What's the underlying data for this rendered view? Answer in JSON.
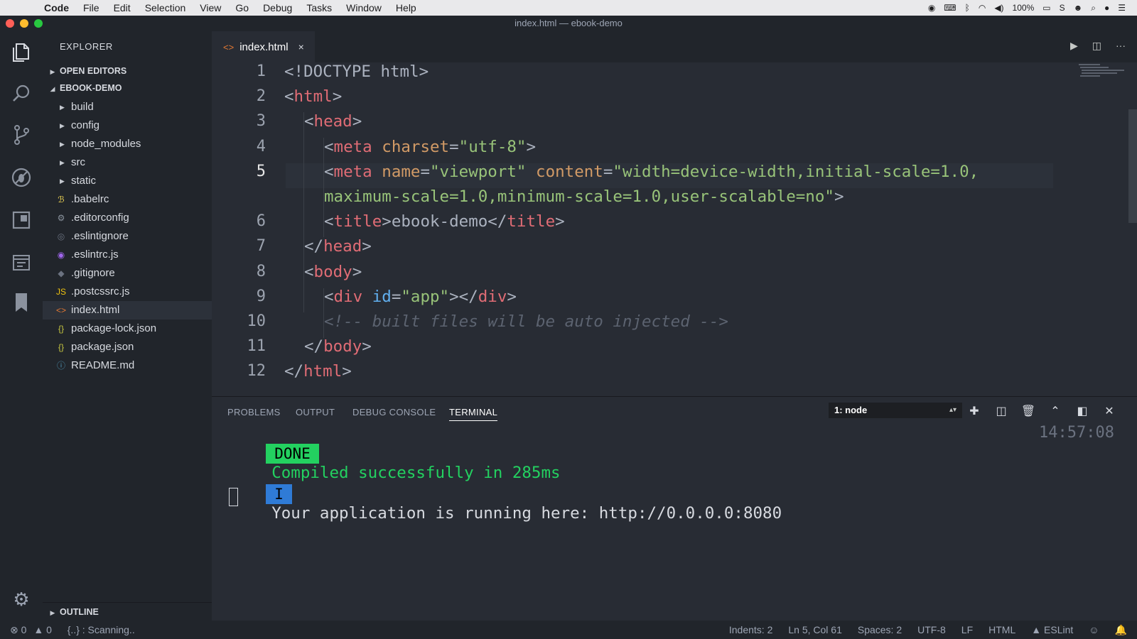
{
  "menubar": {
    "app": "Code",
    "items": [
      "File",
      "Edit",
      "Selection",
      "View",
      "Go",
      "Debug",
      "Tasks",
      "Window",
      "Help"
    ],
    "battery": "100%"
  },
  "window": {
    "title": "index.html — ebook-demo"
  },
  "sidebar": {
    "title": "EXPLORER",
    "open_editors": "OPEN EDITORS",
    "project": "EBOOK-DEMO",
    "folders": [
      "build",
      "config",
      "node_modules",
      "src",
      "static"
    ],
    "files": [
      {
        "name": ".babelrc",
        "icon": "babel-icon",
        "glyph": "ℬ",
        "color": "#f5da55"
      },
      {
        "name": ".editorconfig",
        "icon": "gear-file-icon",
        "glyph": "⚙",
        "color": "#8b949e"
      },
      {
        "name": ".eslintignore",
        "icon": "eslint-ignore-icon",
        "glyph": "◎",
        "color": "#6b7280"
      },
      {
        "name": ".eslintrc.js",
        "icon": "eslint-icon",
        "glyph": "◉",
        "color": "#a066ec"
      },
      {
        "name": ".gitignore",
        "icon": "git-icon",
        "glyph": "◆",
        "color": "#6b7280"
      },
      {
        "name": ".postcssrc.js",
        "icon": "js-icon",
        "glyph": "JS",
        "color": "#f1c40f"
      },
      {
        "name": "index.html",
        "icon": "html-icon",
        "glyph": "<>",
        "color": "#e37933"
      },
      {
        "name": "package-lock.json",
        "icon": "json-icon",
        "glyph": "{}",
        "color": "#cbcb41"
      },
      {
        "name": "package.json",
        "icon": "json-icon",
        "glyph": "{}",
        "color": "#cbcb41"
      },
      {
        "name": "README.md",
        "icon": "info-icon",
        "glyph": "ⓘ",
        "color": "#519aba"
      }
    ],
    "outline": "OUTLINE"
  },
  "tab": {
    "label": "index.html",
    "close": "×"
  },
  "editor": {
    "line_numbers": [
      "1",
      "2",
      "3",
      "4",
      "5",
      "6",
      "7",
      "8",
      "9",
      "10",
      "11",
      "12"
    ],
    "lines": [
      [
        {
          "t": "<!DOCTYPE html>",
          "c": "#abb2bf"
        }
      ],
      [
        {
          "t": "<",
          "c": "#abb2bf"
        },
        {
          "t": "html",
          "c": "#e06c75"
        },
        {
          "t": ">",
          "c": "#abb2bf"
        }
      ],
      [
        {
          "t": "<",
          "c": "#abb2bf"
        },
        {
          "t": "head",
          "c": "#e06c75"
        },
        {
          "t": ">",
          "c": "#abb2bf"
        }
      ],
      [
        {
          "t": "<",
          "c": "#abb2bf"
        },
        {
          "t": "meta",
          "c": "#e06c75"
        },
        {
          "t": " ",
          "c": "#abb2bf"
        },
        {
          "t": "charset",
          "c": "#d19a66"
        },
        {
          "t": "=",
          "c": "#abb2bf"
        },
        {
          "t": "\"utf-8\"",
          "c": "#98c379"
        },
        {
          "t": ">",
          "c": "#abb2bf"
        }
      ],
      [
        {
          "t": "<",
          "c": "#abb2bf"
        },
        {
          "t": "meta",
          "c": "#e06c75"
        },
        {
          "t": " ",
          "c": "#abb2bf"
        },
        {
          "t": "name",
          "c": "#d19a66"
        },
        {
          "t": "=",
          "c": "#abb2bf"
        },
        {
          "t": "\"viewport\"",
          "c": "#98c379"
        },
        {
          "t": " ",
          "c": "#abb2bf"
        },
        {
          "t": "content",
          "c": "#d19a66"
        },
        {
          "t": "=",
          "c": "#abb2bf"
        },
        {
          "t": "\"width=device-width,initial-scale=1.0,",
          "c": "#98c379"
        }
      ],
      [
        {
          "t": "maximum-scale=1.0,minimum-scale=1.0,user-scalable=no\"",
          "c": "#98c379"
        },
        {
          "t": ">",
          "c": "#abb2bf"
        }
      ],
      [
        {
          "t": "<",
          "c": "#abb2bf"
        },
        {
          "t": "title",
          "c": "#e06c75"
        },
        {
          "t": ">ebook-demo</",
          "c": "#abb2bf"
        },
        {
          "t": "title",
          "c": "#e06c75"
        },
        {
          "t": ">",
          "c": "#abb2bf"
        }
      ],
      [
        {
          "t": "</",
          "c": "#abb2bf"
        },
        {
          "t": "head",
          "c": "#e06c75"
        },
        {
          "t": ">",
          "c": "#abb2bf"
        }
      ],
      [
        {
          "t": "<",
          "c": "#abb2bf"
        },
        {
          "t": "body",
          "c": "#e06c75"
        },
        {
          "t": ">",
          "c": "#abb2bf"
        }
      ],
      [
        {
          "t": "<",
          "c": "#abb2bf"
        },
        {
          "t": "div",
          "c": "#e06c75"
        },
        {
          "t": " ",
          "c": "#abb2bf"
        },
        {
          "t": "id",
          "c": "#61afef"
        },
        {
          "t": "=",
          "c": "#abb2bf"
        },
        {
          "t": "\"app\"",
          "c": "#98c379"
        },
        {
          "t": "></",
          "c": "#abb2bf"
        },
        {
          "t": "div",
          "c": "#e06c75"
        },
        {
          "t": ">",
          "c": "#abb2bf"
        }
      ],
      [
        {
          "t": "<!-- built files will be auto injected -->",
          "c": "#5c6370",
          "i": true
        }
      ],
      [
        {
          "t": "</",
          "c": "#abb2bf"
        },
        {
          "t": "body",
          "c": "#e06c75"
        },
        {
          "t": ">",
          "c": "#abb2bf"
        }
      ],
      [
        {
          "t": "</",
          "c": "#abb2bf"
        },
        {
          "t": "html",
          "c": "#e06c75"
        },
        {
          "t": ">",
          "c": "#abb2bf"
        }
      ]
    ]
  },
  "panel": {
    "tabs": [
      "PROBLEMS",
      "OUTPUT",
      "DEBUG CONSOLE",
      "TERMINAL"
    ],
    "terminal_select": "1: node",
    "done_badge": "DONE",
    "done_message": "Compiled successfully in 285ms",
    "info_badge": "I",
    "info_message": "Your application is running here: http://0.0.0.0:8080",
    "time": "14:57:08"
  },
  "status": {
    "errors": "0",
    "warnings": "0",
    "scanning": "{..} : Scanning..",
    "indents": "Indents: 2",
    "position": "Ln 5, Col 61",
    "spaces": "Spaces: 2",
    "encoding": "UTF-8",
    "eol": "LF",
    "language": "HTML",
    "eslint": "ESLint"
  }
}
